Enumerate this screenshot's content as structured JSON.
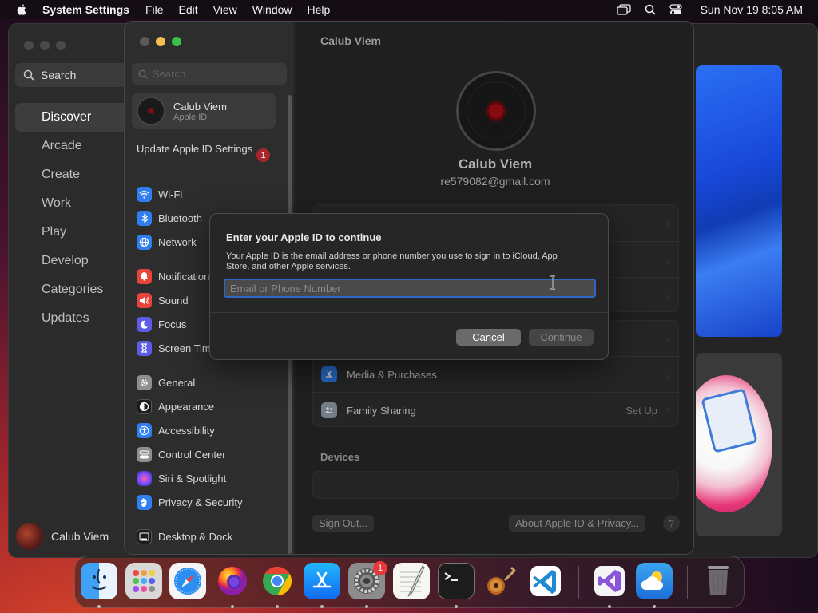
{
  "menubar": {
    "app_name": "System Settings",
    "menus": [
      "File",
      "Edit",
      "View",
      "Window",
      "Help"
    ],
    "clock": "Sun Nov 19  8:05 AM"
  },
  "appstore": {
    "search_label": "Search",
    "nav": [
      "Discover",
      "Arcade",
      "Create",
      "Work",
      "Play",
      "Develop",
      "Categories",
      "Updates"
    ],
    "active_nav": "Discover",
    "user_name": "Calub Viem"
  },
  "settings": {
    "search_placeholder": "Search",
    "account": {
      "name": "Calub Viem",
      "subtitle": "Apple ID"
    },
    "update_text": "Update Apple ID Settings",
    "update_badge": "1",
    "sidebar_items": [
      {
        "label": "Wi-Fi",
        "icon": "wifi-icon",
        "color": "#2f7ff0"
      },
      {
        "label": "Bluetooth",
        "icon": "bluetooth-icon",
        "color": "#2f7ff0"
      },
      {
        "label": "Network",
        "icon": "network-icon",
        "color": "#2f7ff0"
      },
      {
        "label": "Notifications",
        "icon": "bell-icon",
        "color": "#e9443a"
      },
      {
        "label": "Sound",
        "icon": "speaker-icon",
        "color": "#e9443a"
      },
      {
        "label": "Focus",
        "icon": "moon-icon",
        "color": "#5e5ce6"
      },
      {
        "label": "Screen Time",
        "icon": "hourglass-icon",
        "color": "#5e5ce6"
      },
      {
        "label": "General",
        "icon": "gear-icon",
        "color": "#8e8e93"
      },
      {
        "label": "Appearance",
        "icon": "appearance-icon",
        "color": "#1c1c1e"
      },
      {
        "label": "Accessibility",
        "icon": "accessibility-icon",
        "color": "#2f7ff0"
      },
      {
        "label": "Control Center",
        "icon": "control-center-icon",
        "color": "#8e8e93"
      },
      {
        "label": "Siri & Spotlight",
        "icon": "siri-icon",
        "color": "#c0399d"
      },
      {
        "label": "Privacy & Security",
        "icon": "hand-icon",
        "color": "#2f7ff0"
      },
      {
        "label": "Desktop & Dock",
        "icon": "dock-icon",
        "color": "#1c1c1e"
      }
    ],
    "main": {
      "title": "Calub Viem",
      "name": "Calub Viem",
      "email": "re579082@gmail.com",
      "rows": [
        {
          "label": "Media & Purchases",
          "value": "",
          "icon": "app-store-icon"
        },
        {
          "label": "Family Sharing",
          "value": "Set Up",
          "icon": "family-icon"
        }
      ],
      "devices_heading": "Devices",
      "sign_out": "Sign Out...",
      "about": "About Apple ID & Privacy...",
      "help": "?"
    }
  },
  "dialog": {
    "title": "Enter your Apple ID to continue",
    "description": "Your Apple ID is the email address or phone number you use to sign in to iCloud, App Store, and other Apple services.",
    "input_placeholder": "Email or Phone Number",
    "input_value": "",
    "cancel": "Cancel",
    "continue": "Continue"
  },
  "dock": {
    "apps": [
      "Finder",
      "Launchpad",
      "Safari",
      "Firefox",
      "Chrome",
      "App Store",
      "System Settings",
      "TextEdit",
      "Terminal",
      "Instruments",
      "Visual Studio Code",
      "Visual Studio",
      "Weather",
      "Trash"
    ],
    "settings_badge": "1"
  }
}
